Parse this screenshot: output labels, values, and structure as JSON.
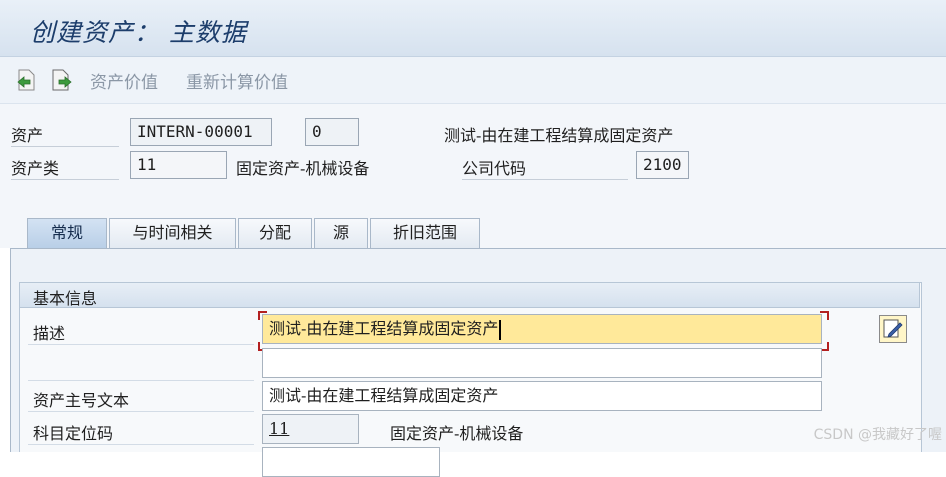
{
  "window": {
    "title": "创建资产： 主数据"
  },
  "toolbar": {
    "asset_value_label": "资产价值",
    "recalc_label": "重新计算价值"
  },
  "header": {
    "asset_label": "资产",
    "asset_number": "INTERN-00001",
    "sub_number": "0",
    "asset_description": "测试-由在建工程结算成固定资产",
    "asset_class_label": "资产类",
    "asset_class": "11",
    "asset_class_description": "固定资产-机械设备",
    "company_code_label": "公司代码",
    "company_code": "2100"
  },
  "tabs": [
    {
      "label": "常规",
      "active": true
    },
    {
      "label": "与时间相关",
      "active": false
    },
    {
      "label": "分配",
      "active": false
    },
    {
      "label": "源",
      "active": false
    },
    {
      "label": "折旧范围",
      "active": false
    }
  ],
  "general": {
    "group_title": "基本信息",
    "description_label": "描述",
    "description_value": "测试-由在建工程结算成固定资产",
    "description_line2": "",
    "main_text_label": "资产主号文本",
    "main_text_value": "测试-由在建工程结算成固定资产",
    "account_key_label": "科目定位码",
    "account_key_value": "11",
    "account_key_description": "固定资产-机械设备"
  },
  "watermark": "CSDN @我藏好了喔",
  "colors": {
    "title": "#1c3d6b",
    "focus_field": "#ffe99a",
    "active_tab": "#b9cfe7"
  }
}
